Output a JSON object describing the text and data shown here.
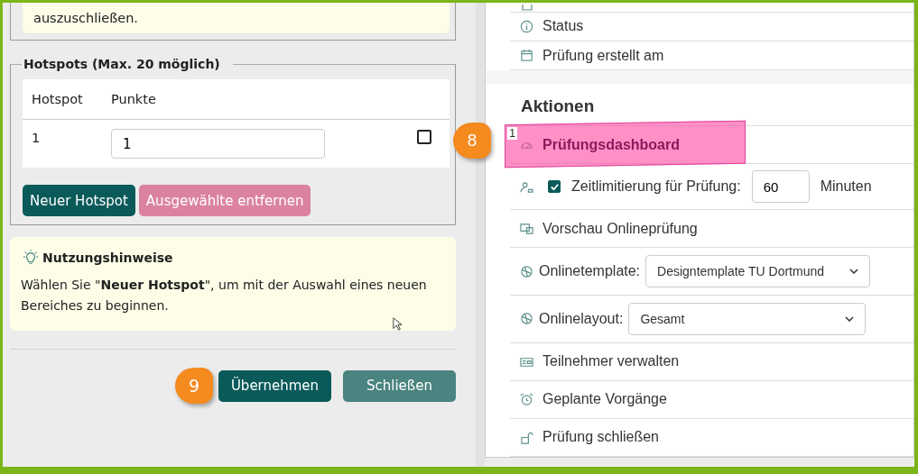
{
  "left": {
    "note": "auszuschließen.",
    "hotspots": {
      "legend": "Hotspots (Max. 20 möglich)",
      "columns": [
        "Hotspot",
        "Punkte"
      ],
      "rows": [
        {
          "hotspot": "1",
          "points": "1",
          "checked": false
        }
      ],
      "buttons": [
        {
          "label": "Neuer Hotspot",
          "disabled": false
        },
        {
          "label": "Ausgewählte entfernen",
          "disabled": true
        }
      ]
    },
    "hint": {
      "title": "Nutzungshinweise",
      "text": "Wählen Sie \"**Neuer Hotspot**\", um mit der Auswahl eines neuen Bereiches zu beginnen."
    },
    "footer": {
      "callout": "9",
      "buttons": [
        {
          "label": "Übernehmen",
          "kind": "primary"
        },
        {
          "label": "Schließen",
          "kind": "secondary"
        }
      ]
    }
  },
  "right": {
    "info": [
      "Status",
      "Prüfung erstellt am"
    ],
    "actions_title": "Aktionen",
    "actions": [
      {
        "kind": "link",
        "label": "Prüfungsdashboard",
        "highlighted": true,
        "marker": "1",
        "callout": "8"
      },
      {
        "kind": "checkbox",
        "label": "Zeitlimitierung für Prüfung:",
        "checked": true,
        "value": "60",
        "unit": "Minuten"
      },
      {
        "kind": "link",
        "label": "Vorschau Onlineprüfung",
        "highlighted": false
      },
      {
        "kind": "select",
        "label": "Onlinetemplate:",
        "value": "Designtemplate TU Dortmund"
      },
      {
        "kind": "select",
        "label": "Onlinelayout:",
        "value": "Gesamt"
      },
      {
        "kind": "link",
        "label": "Teilnehmer verwalten",
        "highlighted": false
      },
      {
        "kind": "link",
        "label": "Geplante Vorgänge",
        "highlighted": false
      },
      {
        "kind": "link",
        "label": "Prüfung schließen",
        "highlighted": false
      }
    ]
  }
}
